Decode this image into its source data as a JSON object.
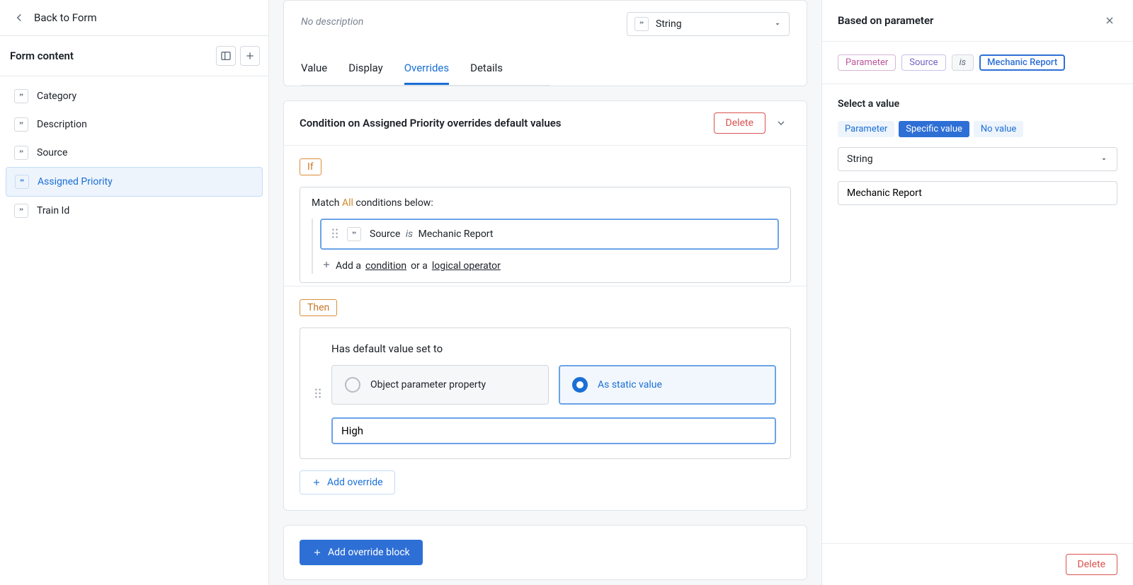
{
  "back_label": "Back to Form",
  "form_section_title": "Form content",
  "form_items": [
    {
      "label": "Category",
      "active": false
    },
    {
      "label": "Description",
      "active": false
    },
    {
      "label": "Source",
      "active": false
    },
    {
      "label": "Assigned Priority",
      "active": true
    },
    {
      "label": "Train Id",
      "active": false
    }
  ],
  "topcard": {
    "description": "No description",
    "type_value": "String",
    "tabs": [
      "Value",
      "Display",
      "Overrides",
      "Details"
    ],
    "active_tab": "Overrides"
  },
  "condition_card": {
    "title": "Condition on Assigned Priority overrides default values",
    "delete_label": "Delete",
    "if_label": "If",
    "match_prefix": "Match",
    "match_all": "All",
    "match_suffix": "conditions below:",
    "cond_param": "Source",
    "cond_op": "is",
    "cond_value": "Mechanic Report",
    "add_cond_prefix": "Add a ",
    "add_cond_link1": "condition",
    "add_cond_mid": " or a ",
    "add_cond_link2": "logical operator",
    "then_label": "Then",
    "then_title": "Has default value set to",
    "radio_option1": "Object parameter property",
    "radio_option2": "As static value",
    "static_value": "High",
    "add_override_label": "Add override"
  },
  "add_block_label": "Add override block",
  "right": {
    "title": "Based on parameter",
    "chips": {
      "param": "Parameter",
      "source": "Source",
      "is": "is",
      "value": "Mechanic Report"
    },
    "select_label": "Select a value",
    "segs": [
      "Parameter",
      "Specific value",
      "No value"
    ],
    "active_seg": "Specific value",
    "type": "String",
    "value": "Mechanic Report",
    "delete_label": "Delete"
  }
}
